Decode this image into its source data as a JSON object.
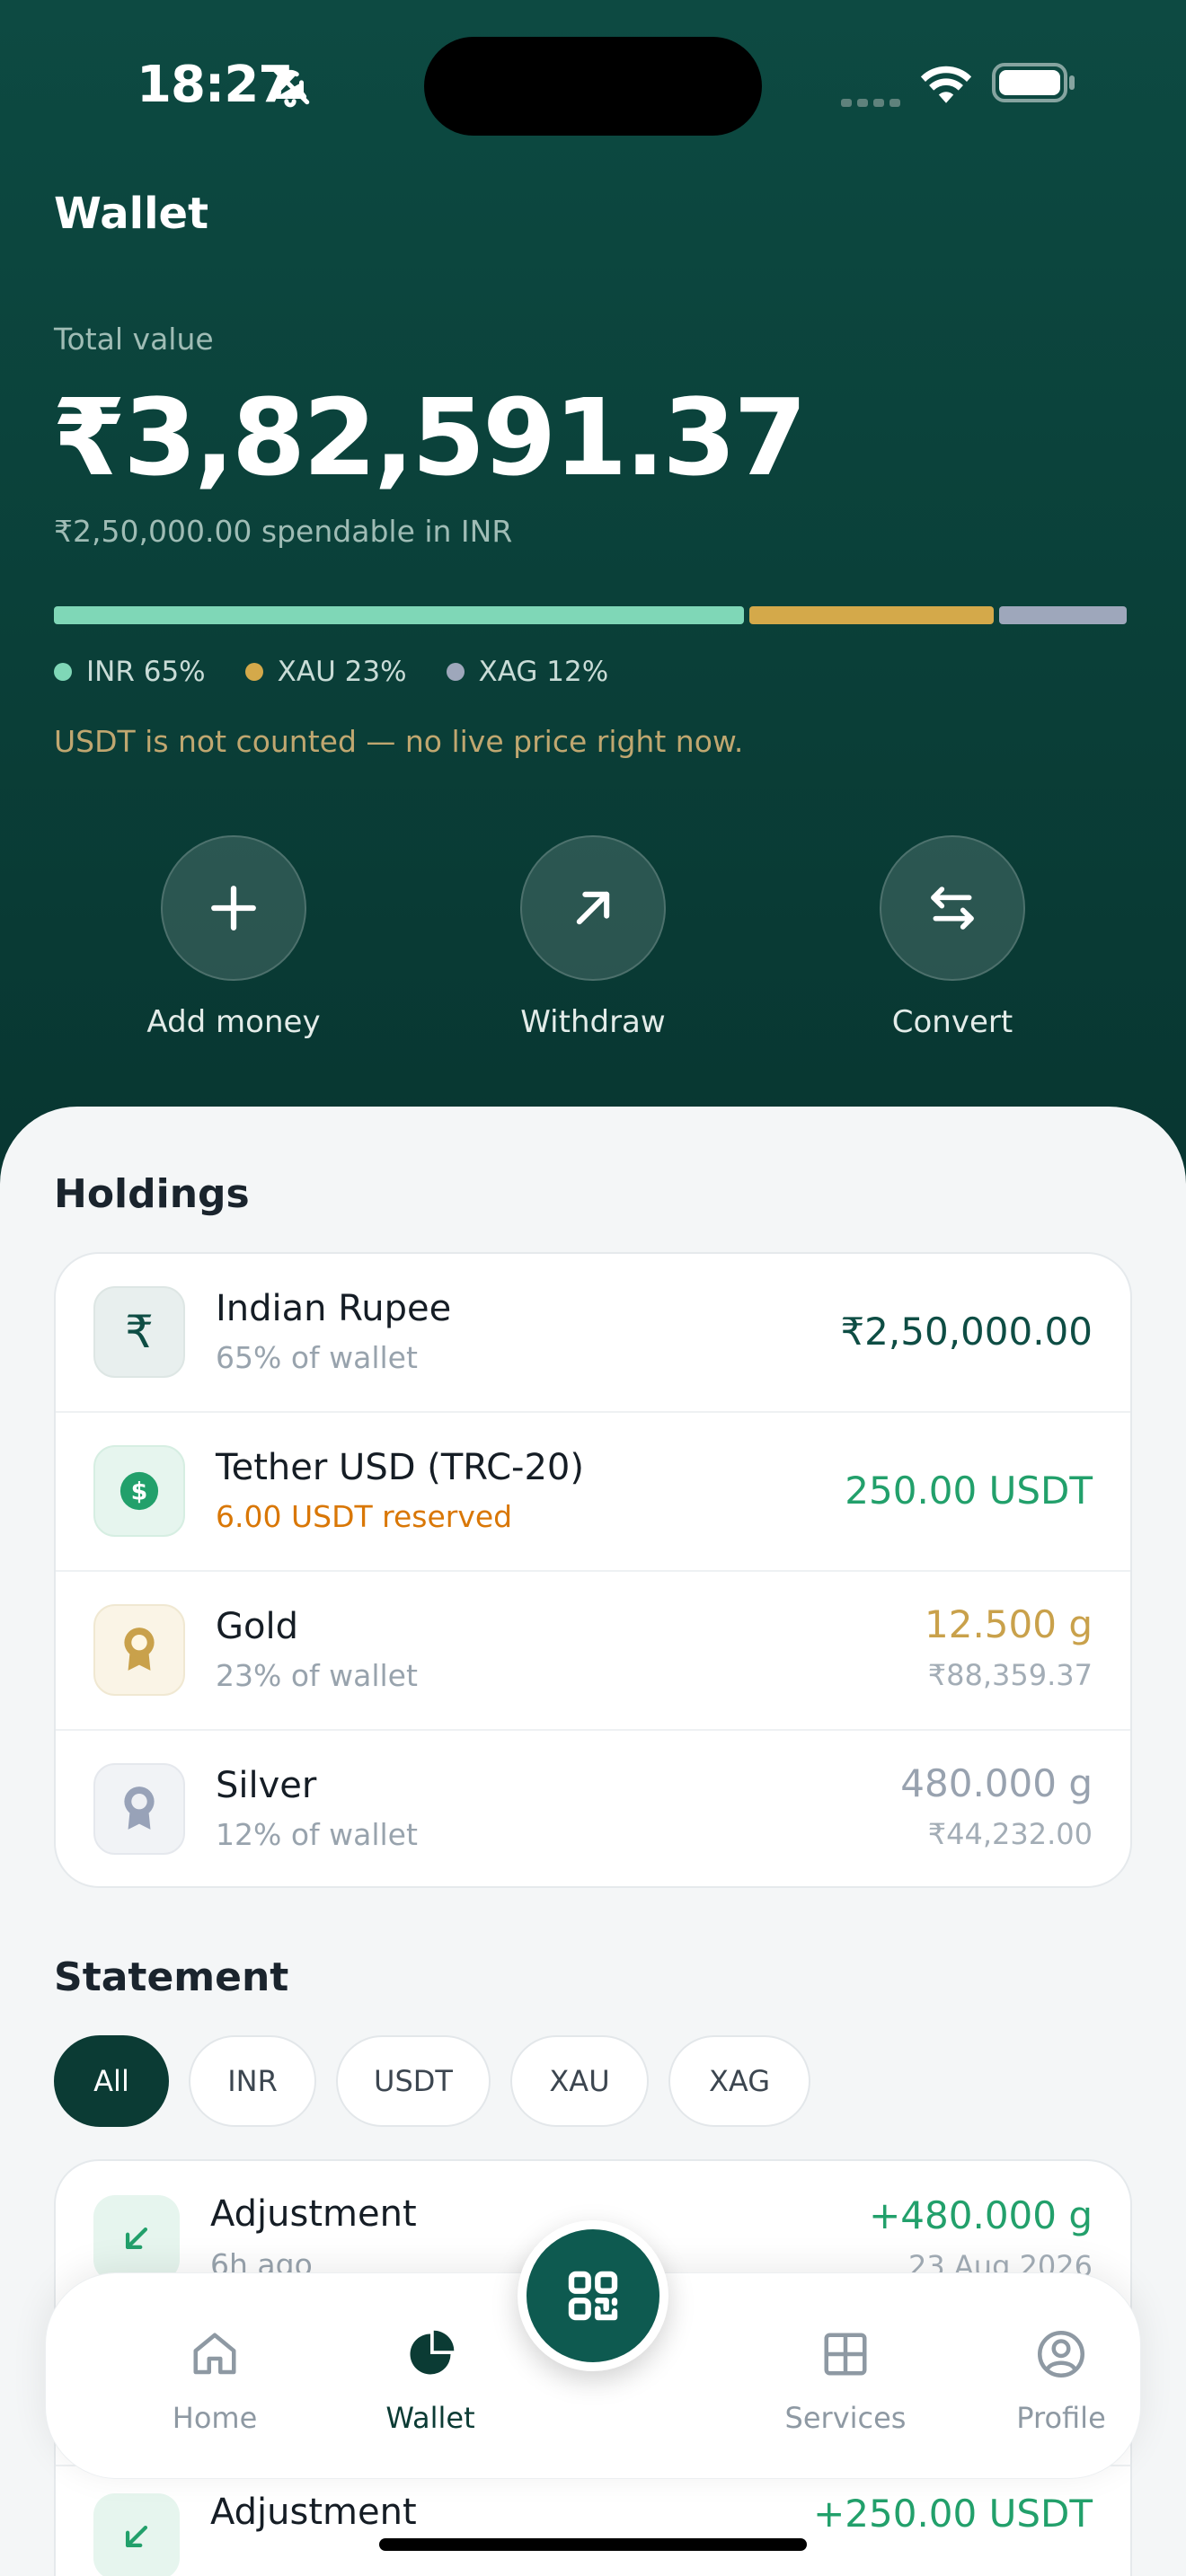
{
  "status": {
    "time": "18:27"
  },
  "header": {
    "title": "Wallet"
  },
  "summary": {
    "total_label": "Total value",
    "total_value": "₹3,82,591.37",
    "spendable": "₹2,50,000.00 spendable in INR",
    "notice": "USDT is not counted — no live price right now."
  },
  "allocation": [
    {
      "label": "INR 65%",
      "percent": 65,
      "color": "#7fd7b7"
    },
    {
      "label": "XAU 23%",
      "percent": 23,
      "color": "#d4a94a"
    },
    {
      "label": "XAG 12%",
      "percent": 12,
      "color": "#9ea7bb"
    }
  ],
  "actions": [
    {
      "label": "Add money",
      "icon": "plus-icon"
    },
    {
      "label": "Withdraw",
      "icon": "arrow-up-right-icon"
    },
    {
      "label": "Convert",
      "icon": "swap-icon"
    }
  ],
  "holdings": {
    "title": "Holdings",
    "items": [
      {
        "name": "Indian Rupee",
        "sub": "65% of wallet",
        "value": "₹2,50,000.00",
        "value2": "",
        "icon": "rupee-icon",
        "value_color": "#0e4d44",
        "sub_color": "#98a3ad"
      },
      {
        "name": "Tether USD (TRC-20)",
        "sub": "6.00 USDT reserved",
        "value": "250.00 USDT",
        "value2": "",
        "icon": "dollar-coin-icon",
        "value_color": "#22a06b",
        "sub_color": "#d97706"
      },
      {
        "name": "Gold",
        "sub": "23% of wallet",
        "value": "12.500 g",
        "value2": "₹88,359.37",
        "icon": "gold-medal-icon",
        "value_color": "#c9a14b",
        "sub_color": "#98a3ad"
      },
      {
        "name": "Silver",
        "sub": "12% of wallet",
        "value": "480.000 g",
        "value2": "₹44,232.00",
        "icon": "silver-medal-icon",
        "value_color": "#98a2af",
        "sub_color": "#98a3ad"
      }
    ]
  },
  "statement": {
    "title": "Statement",
    "filters": [
      "All",
      "INR",
      "USDT",
      "XAU",
      "XAG"
    ],
    "active_filter": "All",
    "transactions": [
      {
        "title": "Adjustment",
        "sub": "6h ago",
        "amount": "+480.000 g",
        "date": "23 Aug 2026"
      },
      {
        "title": "Adjustment",
        "sub": "",
        "amount": "+250.00 USDT",
        "date": ""
      }
    ]
  },
  "tabbar": {
    "items": [
      {
        "label": "Home",
        "icon": "home-icon",
        "active": false
      },
      {
        "label": "Wallet",
        "icon": "wallet-pie-icon",
        "active": true
      },
      {
        "label": "Services",
        "icon": "grid-icon",
        "active": false
      },
      {
        "label": "Profile",
        "icon": "profile-icon",
        "active": false
      }
    ],
    "scan_icon": "qr-scan-icon"
  },
  "colors": {
    "brand_dark": "#0b3b34",
    "brand": "#0e5a50",
    "positive": "#22a06b"
  }
}
